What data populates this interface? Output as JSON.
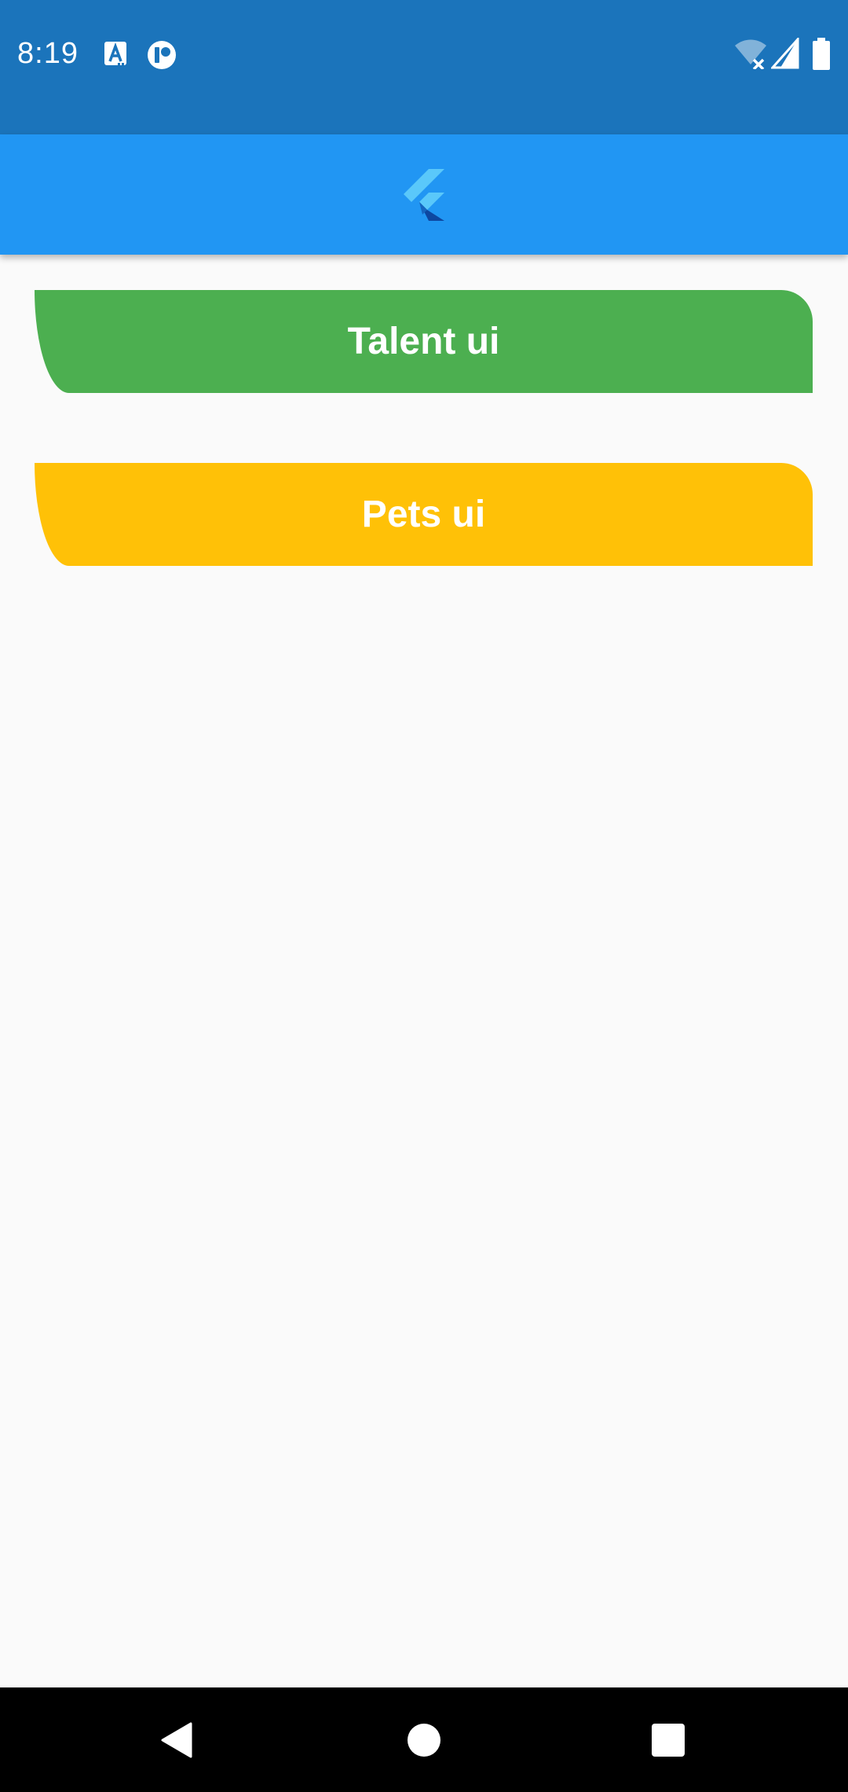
{
  "status_bar": {
    "time": "8:19",
    "left_icons": [
      "translate-icon",
      "pinterest-like-icon"
    ],
    "right_icons": [
      "wifi-off-icon",
      "cell-signal-icon",
      "battery-icon"
    ],
    "background": "#1b74bb"
  },
  "app_bar": {
    "logo": "flutter-logo-icon",
    "background": "#2196f3"
  },
  "buttons": [
    {
      "label": "Talent ui",
      "color": "#4caf50"
    },
    {
      "label": "Pets ui",
      "color": "#ffc107"
    }
  ],
  "nav_bar": {
    "keys": [
      "back-icon",
      "home-icon",
      "recents-icon"
    ]
  }
}
